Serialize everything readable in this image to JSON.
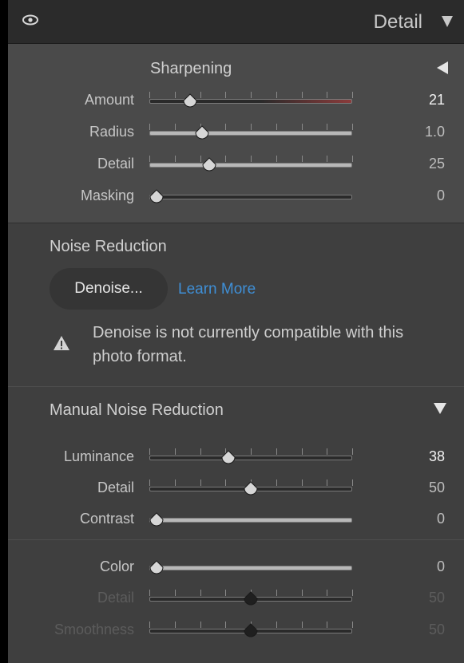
{
  "header": {
    "title": "Detail",
    "eye_icon": "eye-icon",
    "collapse_icon": "triangle-down-icon"
  },
  "sharpening": {
    "title": "Sharpening",
    "sliders": [
      {
        "label": "Amount",
        "value": "21",
        "fraction": 0.18
      },
      {
        "label": "Radius",
        "value": "1.0",
        "fraction": 0.24
      },
      {
        "label": "Detail",
        "value": "25",
        "fraction": 0.28
      },
      {
        "label": "Masking",
        "value": "0",
        "fraction": 0.0
      }
    ]
  },
  "noise_reduction": {
    "title": "Noise Reduction",
    "denoise_button": "Denoise...",
    "learn_more": "Learn More",
    "warning": "Denoise is not currently compatible with this photo format."
  },
  "manual_noise": {
    "title": "Manual Noise Reduction",
    "luminance": [
      {
        "label": "Luminance",
        "value": "38",
        "fraction": 0.38
      },
      {
        "label": "Detail",
        "value": "50",
        "fraction": 0.5
      },
      {
        "label": "Contrast",
        "value": "0",
        "fraction": 0.0
      }
    ],
    "color": [
      {
        "label": "Color",
        "value": "0",
        "fraction": 0.0
      },
      {
        "label": "Detail",
        "value": "50",
        "fraction": 0.5
      },
      {
        "label": "Smoothness",
        "value": "50",
        "fraction": 0.5
      }
    ]
  },
  "colors": {
    "accent": "#3f8fd6",
    "panel": "#3d3d3d"
  }
}
